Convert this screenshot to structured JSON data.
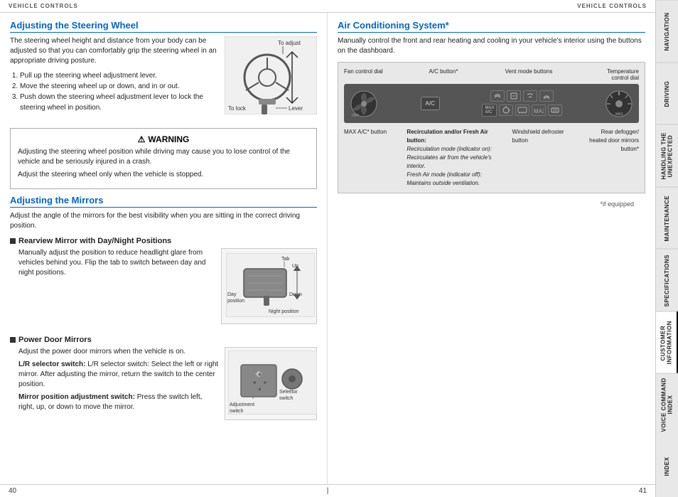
{
  "header": {
    "left_label": "VEHICLE CONTROLS",
    "right_label": "VEHICLE CONTROLS"
  },
  "left_page": {
    "page_number": "40",
    "steering_section": {
      "title": "Adjusting the Steering Wheel",
      "body": "The steering wheel height and distance from your body can be adjusted so that you can comfortably grip the steering wheel in an appropriate driving posture.",
      "steps": [
        "Pull up the steering wheel adjustment lever.",
        "Move the steering wheel up or down, and in or out.",
        "Push down the steering wheel adjustment lever to lock the steering wheel in position."
      ],
      "diagram_labels": {
        "to_adjust": "To adjust",
        "to_lock": "To lock",
        "lever": "Lever"
      }
    },
    "warning_section": {
      "title": "WARNING",
      "lines": [
        "Adjusting the steering wheel position while driving may cause you to lose control of the vehicle and be seriously injured in a crash.",
        "Adjust the steering wheel only when the vehicle is stopped."
      ]
    },
    "mirrors_section": {
      "title": "Adjusting the Mirrors",
      "body": "Adjust the angle of the mirrors for the best visibility when you are sitting in the correct driving position.",
      "rearview_subsection": {
        "title": "Rearview Mirror with Day/Night Positions",
        "body": "Manually adjust the position to reduce headlight glare from vehicles behind you. Flip the tab to switch between day and night positions.",
        "diagram_labels": {
          "tab": "Tab",
          "up": "Up",
          "day_position": "Day position",
          "down": "Down",
          "night_position": "Night position"
        }
      },
      "power_door_subsection": {
        "title": "Power Door Mirrors",
        "body": "Adjust the power door mirrors when the vehicle is on.",
        "lr_selector": "L/R selector switch: Select the left or right mirror. After adjusting the mirror, return the switch to the center position.",
        "mirror_position": "Mirror position adjustment switch: Press the switch left, right, up, or down to move the mirror.",
        "diagram_labels": {
          "adjustment_switch": "Adjustment switch",
          "selector_switch": "Selector switch"
        }
      }
    }
  },
  "right_page": {
    "page_number": "41",
    "footnote": "*if equipped",
    "ac_section": {
      "title": "Air Conditioning System*",
      "body": "Manually control the front and rear heating and cooling in your vehicle's interior using the buttons on the dashboard.",
      "labels": {
        "fan_control_dial": "Fan control dial",
        "ac_button": "A/C button*",
        "vent_mode_buttons": "Vent mode buttons",
        "temperature_control_dial": "Temperature control dial",
        "max_ac_button": "MAX A/C* button",
        "recirculation_button": "Recirculation and/or Fresh Air button:",
        "recirculation_on": "Recirculation mode (indicator on): Recirculates air from the vehicle's interior.",
        "fresh_air_mode": "Fresh Air mode (indicator off): Maintains outside ventilation.",
        "windshield_defroster": "Windshield defroster button",
        "rear_defogger": "Rear defogger/ heated door mirrors button*",
        "ac_label": "A/C",
        "max_ac_label": "MAX A/C"
      }
    }
  },
  "sidebar": {
    "items": [
      {
        "label": "NAVIGATION",
        "active": false
      },
      {
        "label": "DRIVING",
        "active": false
      },
      {
        "label": "HANDLING THE UNEXPECTED",
        "active": false
      },
      {
        "label": "MAINTENANCE",
        "active": false
      },
      {
        "label": "SPECIFICATIONS",
        "active": false
      },
      {
        "label": "CUSTOMER INFORMATION",
        "active": false
      },
      {
        "label": "VOICE COMMAND INDEX",
        "active": false
      },
      {
        "label": "INDEX",
        "active": false
      }
    ]
  }
}
